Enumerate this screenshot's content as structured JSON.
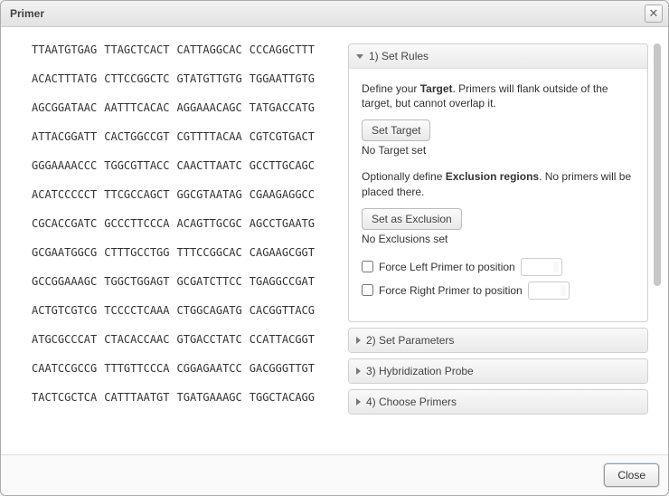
{
  "window": {
    "title": "Primer"
  },
  "sequence_lines": [
    [
      "TTAATGTGAG",
      "TTAGCTCACT",
      "CATTAGGCAC",
      "CCCAGGCTTT"
    ],
    [
      "ACACTTTATG",
      "CTTCCGGCTC",
      "GTATGTTGTG",
      "TGGAATTGTG"
    ],
    [
      "AGCGGATAAC",
      "AATTTCACAC",
      "AGGAAACAGC",
      "TATGACCATG"
    ],
    [
      "ATTACGGATT",
      "CACTGGCCGT",
      "CGTTTTACAA",
      "CGTCGTGACT"
    ],
    [
      "GGGAAAACCC",
      "TGGCGTTACC",
      "CAACTTAATC",
      "GCCTTGCAGC"
    ],
    [
      "ACATCCCCCT",
      "TTCGCCAGCT",
      "GGCGTAATAG",
      "CGAAGAGGCC"
    ],
    [
      "CGCACCGATC",
      "GCCCTTCCCA",
      "ACAGTTGCGC",
      "AGCCTGAATG"
    ],
    [
      "GCGAATGGCG",
      "CTTTGCCTGG",
      "TTTCCGGCAC",
      "CAGAAGCGGT"
    ],
    [
      "GCCGGAAAGC",
      "TGGCTGGAGT",
      "GCGATCTTCC",
      "TGAGGCCGAT"
    ],
    [
      "ACTGTCGTCG",
      "TCCCCTCAAA",
      "CTGGCAGATG",
      "CACGGTTACG"
    ],
    [
      "ATGCGCCCAT",
      "CTACACCAAC",
      "GTGACCTATC",
      "CCATTACGGT"
    ],
    [
      "CAATCCGCCG",
      "TTTGTTCCCA",
      "CGGAGAATCC",
      "GACGGGTTGT"
    ],
    [
      "TACTCGCTCA",
      "CATTTAATGT",
      "TGATGAAAGC",
      "TGGCTACAGG"
    ]
  ],
  "accordion": {
    "sections": [
      {
        "label": "1) Set Rules",
        "open": true
      },
      {
        "label": "2) Set Parameters",
        "open": false
      },
      {
        "label": "3) Hybridization Probe",
        "open": false
      },
      {
        "label": "4) Choose Primers",
        "open": false
      }
    ]
  },
  "rules": {
    "target_intro_pre": "Define your ",
    "target_word": "Target",
    "target_intro_post": ". Primers will flank outside of the target, but cannot overlap it.",
    "set_target_btn": "Set Target",
    "target_status": "No Target set",
    "excl_intro_pre": "Optionally define ",
    "excl_word": "Exclusion regions",
    "excl_intro_post": ". No primers will be placed there.",
    "set_excl_btn": "Set as Exclusion",
    "excl_status": "No Exclusions set",
    "force_left_label": "Force Left Primer to position",
    "force_right_label": "Force Right Primer to position"
  },
  "footer": {
    "close": "Close"
  }
}
